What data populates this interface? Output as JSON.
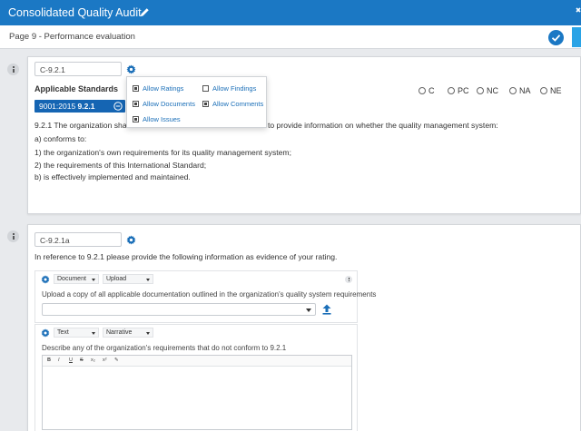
{
  "header": {
    "title": "Consolidated Quality Audit"
  },
  "page": {
    "title": "Page 9 - Performance evaluation"
  },
  "question1": {
    "id": "C-9.2.1",
    "standards_label": "Applicable Standards",
    "standard": {
      "prefix": "9001:2015 ",
      "clause": "9.2.1"
    },
    "settings": [
      {
        "label": "Allow Ratings",
        "checked": true
      },
      {
        "label": "Allow Findings",
        "checked": false
      },
      {
        "label": "Allow Documents",
        "checked": true
      },
      {
        "label": "Allow Comments",
        "checked": true
      },
      {
        "label": "Allow Issues",
        "checked": true
      }
    ],
    "ratings": [
      "C",
      "PC",
      "NC",
      "NA",
      "NE"
    ],
    "text_start": "9.2.1 The organization shall",
    "text_end": "to provide information on whether the quality management system:",
    "lines": [
      "a) conforms to:",
      "1) the organization's own requirements for its quality management system;",
      "2) the requirements of this International Standard;",
      "b) is effectively implemented and maintained."
    ]
  },
  "question2": {
    "id": "C-9.2.1a",
    "text": "In reference to 9.2.1 please provide the following information as evidence of your rating.",
    "doc_section": {
      "type": "Document",
      "mode": "Upload",
      "instruction": "Upload a copy of all applicable documentation outlined in the organization's quality system requirements"
    },
    "text_section": {
      "type": "Text",
      "mode": "Narrative",
      "instruction": "Describe any of the organization's requirements that do not conform to 9.2.1",
      "toolbar": [
        "B",
        "I",
        "U",
        "S",
        "x₂",
        "x²",
        "✎"
      ]
    }
  },
  "colors": {
    "primary": "#1b78c4",
    "pill": "#1565b3",
    "accent_light": "#29a3e6"
  }
}
